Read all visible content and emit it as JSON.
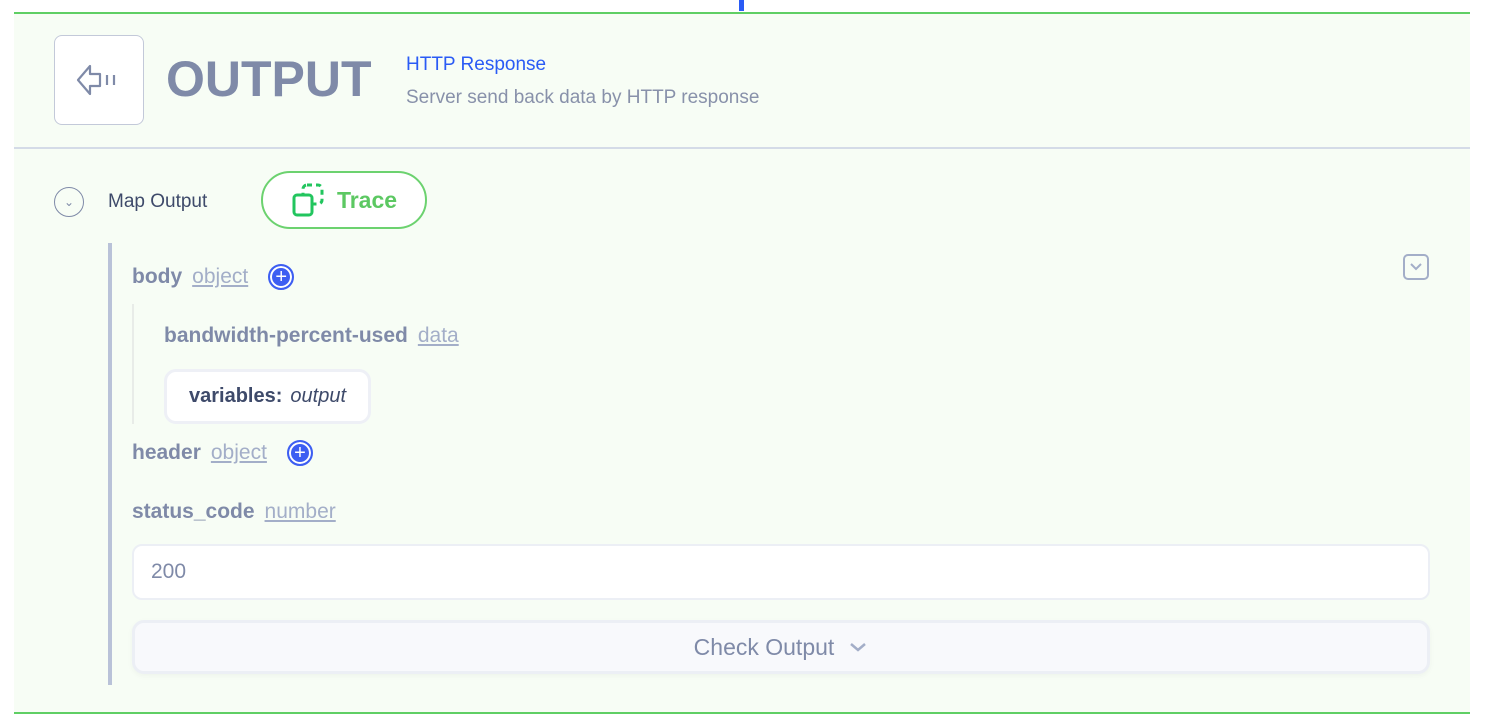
{
  "header": {
    "title": "OUTPUT",
    "subtitle": "HTTP Response",
    "description": "Server send back data by HTTP response",
    "icon": "output-arrow-icon"
  },
  "map_output": {
    "label": "Map Output",
    "trace_label": "Trace"
  },
  "fields": [
    {
      "name": "body",
      "type": "object"
    },
    {
      "name": "bandwidth-percent-used",
      "type": "data"
    },
    {
      "name": "header",
      "type": "object"
    },
    {
      "name": "status_code",
      "type": "number"
    }
  ],
  "variable_chip": {
    "key": "variables:",
    "value": "output"
  },
  "status_code_value": "200",
  "check_output_label": "Check Output",
  "colors": {
    "accent": "#2a5bf5",
    "success": "#5fcf64",
    "text": "#7f8aa8"
  }
}
